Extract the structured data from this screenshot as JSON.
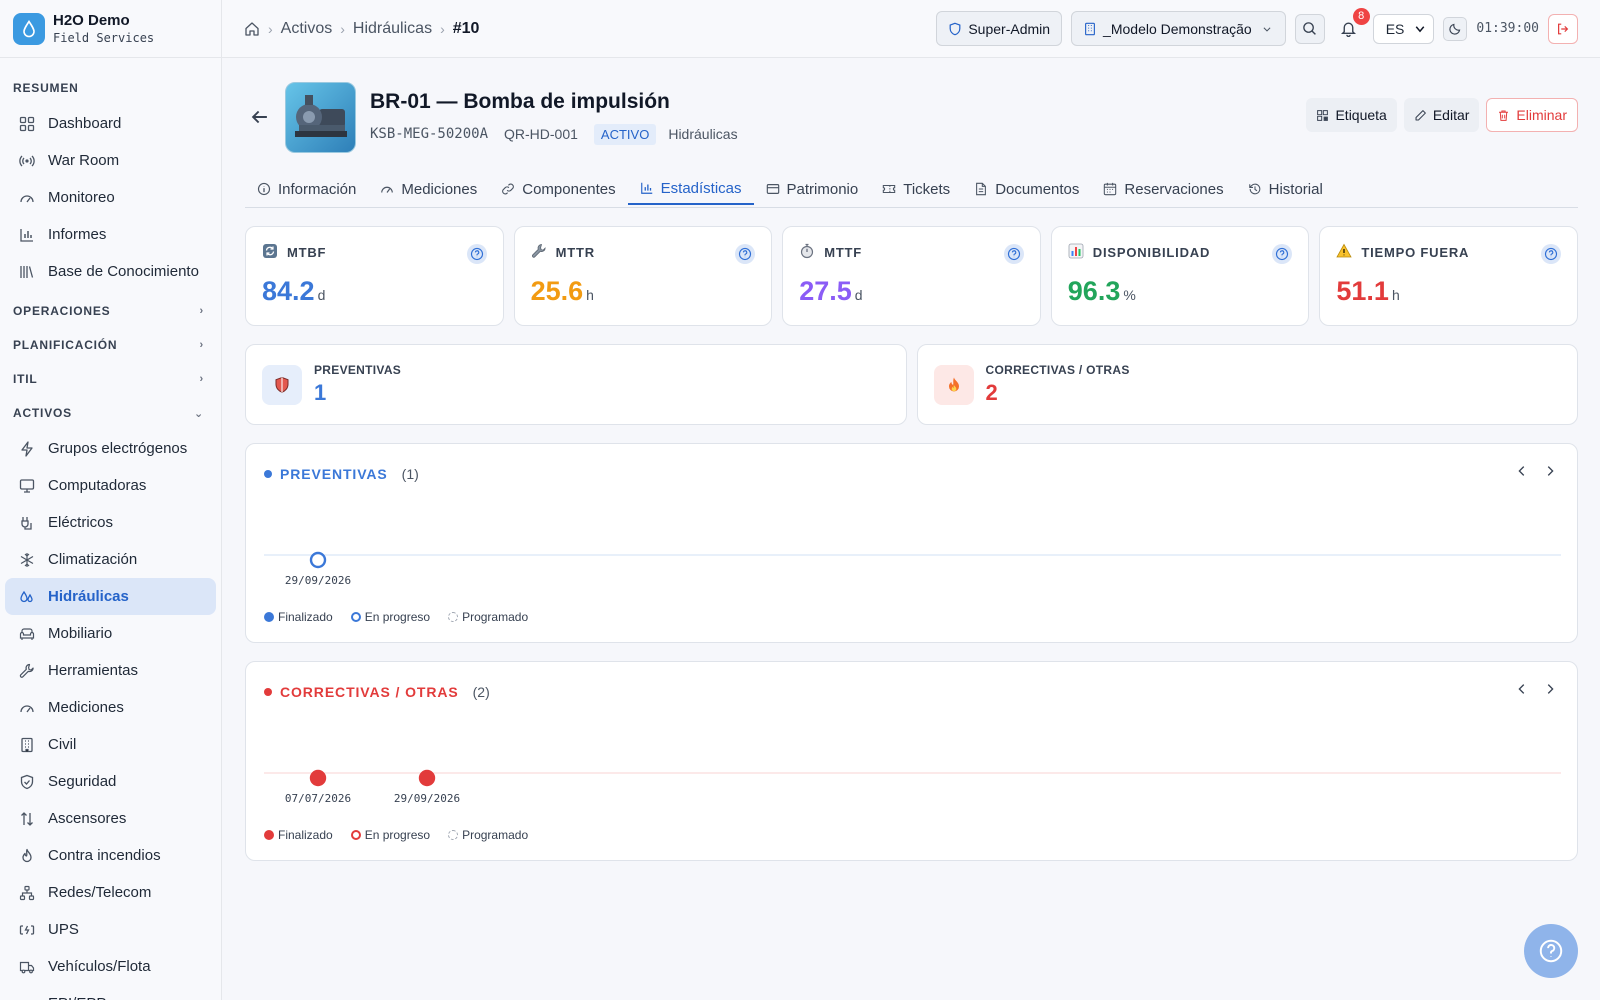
{
  "brand": {
    "name": "H2O Demo",
    "subtitle": "Field Services"
  },
  "sidebar": {
    "sections": {
      "resumen": "RESUMEN",
      "operaciones": "OPERACIONES",
      "planificacion": "PLANIFICACIÓN",
      "itil": "ITIL",
      "activos": "ACTIVOS"
    },
    "resumen_items": [
      {
        "label": "Dashboard",
        "icon": "grid-icon"
      },
      {
        "label": "War Room",
        "icon": "broadcast-icon"
      },
      {
        "label": "Monitoreo",
        "icon": "gauge-icon"
      },
      {
        "label": "Informes",
        "icon": "bar-chart-icon"
      },
      {
        "label": "Base de Conocimiento",
        "icon": "library-icon"
      }
    ],
    "activos_items": [
      {
        "label": "Grupos electrógenos",
        "icon": "bolt-icon"
      },
      {
        "label": "Computadoras",
        "icon": "monitor-icon"
      },
      {
        "label": "Eléctricos",
        "icon": "plug-icon"
      },
      {
        "label": "Climatización",
        "icon": "snowflake-icon"
      },
      {
        "label": "Hidráulicas",
        "icon": "droplets-icon",
        "active": true
      },
      {
        "label": "Mobiliario",
        "icon": "sofa-icon"
      },
      {
        "label": "Herramientas",
        "icon": "wrench-icon"
      },
      {
        "label": "Mediciones",
        "icon": "gauge-icon"
      },
      {
        "label": "Civil",
        "icon": "building-icon"
      },
      {
        "label": "Seguridad",
        "icon": "shield-icon"
      },
      {
        "label": "Ascensores",
        "icon": "arrows-updown-icon"
      },
      {
        "label": "Contra incendios",
        "icon": "flame-icon"
      },
      {
        "label": "Redes/Telecom",
        "icon": "network-icon"
      },
      {
        "label": "UPS",
        "icon": "battery-icon"
      },
      {
        "label": "Vehículos/Flota",
        "icon": "truck-icon"
      },
      {
        "label": "EPI/EPP",
        "icon": "helmet-icon"
      }
    ]
  },
  "header": {
    "breadcrumbs": [
      "Activos",
      "Hidráulicas",
      "#10"
    ],
    "role": "Super-Admin",
    "tenant": "_Modelo Demonstração",
    "notifications": "8",
    "language": "ES",
    "clock": "01:39:00"
  },
  "asset": {
    "title": "BR-01 — Bomba de impulsión",
    "model": "KSB-MEG-50200A",
    "qr": "QR-HD-001",
    "status": "ACTIVO",
    "category": "Hidráulicas"
  },
  "actions": {
    "label": "Etiqueta",
    "edit": "Editar",
    "delete": "Eliminar"
  },
  "tabs": [
    {
      "label": "Información",
      "icon": "info-icon"
    },
    {
      "label": "Mediciones",
      "icon": "gauge-icon"
    },
    {
      "label": "Componentes",
      "icon": "link-icon"
    },
    {
      "label": "Estadísticas",
      "icon": "bar-chart-icon",
      "active": true
    },
    {
      "label": "Patrimonio",
      "icon": "card-icon"
    },
    {
      "label": "Tickets",
      "icon": "ticket-icon"
    },
    {
      "label": "Documentos",
      "icon": "document-icon"
    },
    {
      "label": "Reservaciones",
      "icon": "calendar-icon"
    },
    {
      "label": "Historial",
      "icon": "history-icon"
    }
  ],
  "kpis": [
    {
      "label": "MTBF",
      "value": "84.2",
      "unit": "d",
      "color": "#3b78d8",
      "icon": "refresh-icon"
    },
    {
      "label": "MTTR",
      "value": "25.6",
      "unit": "h",
      "color": "#f29b12",
      "icon": "wrench-icon"
    },
    {
      "label": "MTTF",
      "value": "27.5",
      "unit": "d",
      "color": "#8b5cf6",
      "icon": "stopwatch-icon"
    },
    {
      "label": "DISPONIBILIDAD",
      "value": "96.3",
      "unit": "%",
      "color": "#22a55b",
      "icon": "bar-chart-icon"
    },
    {
      "label": "TIEMPO FUERA",
      "value": "51.1",
      "unit": "h",
      "color": "#e23b3b",
      "icon": "warning-icon"
    }
  ],
  "counts": [
    {
      "label": "PREVENTIVAS",
      "value": "1",
      "color": "#3b78d8",
      "icon": "shield-icon"
    },
    {
      "label": "CORRECTIVAS / OTRAS",
      "value": "2",
      "color": "#e23b3b",
      "icon": "fire-icon"
    }
  ],
  "timelines": [
    {
      "title": "PREVENTIVAS",
      "count": "(1)",
      "color": "#3b78d8",
      "events": [
        {
          "date": "29/09/2026",
          "status": "En progreso"
        }
      ]
    },
    {
      "title": "CORRECTIVAS / OTRAS",
      "count": "(2)",
      "color": "#e23b3b",
      "events": [
        {
          "date": "07/07/2026",
          "status": "Finalizado"
        },
        {
          "date": "29/09/2026",
          "status": "Finalizado"
        }
      ]
    }
  ],
  "legend": {
    "done": "Finalizado",
    "progress": "En progreso",
    "scheduled": "Programado"
  }
}
